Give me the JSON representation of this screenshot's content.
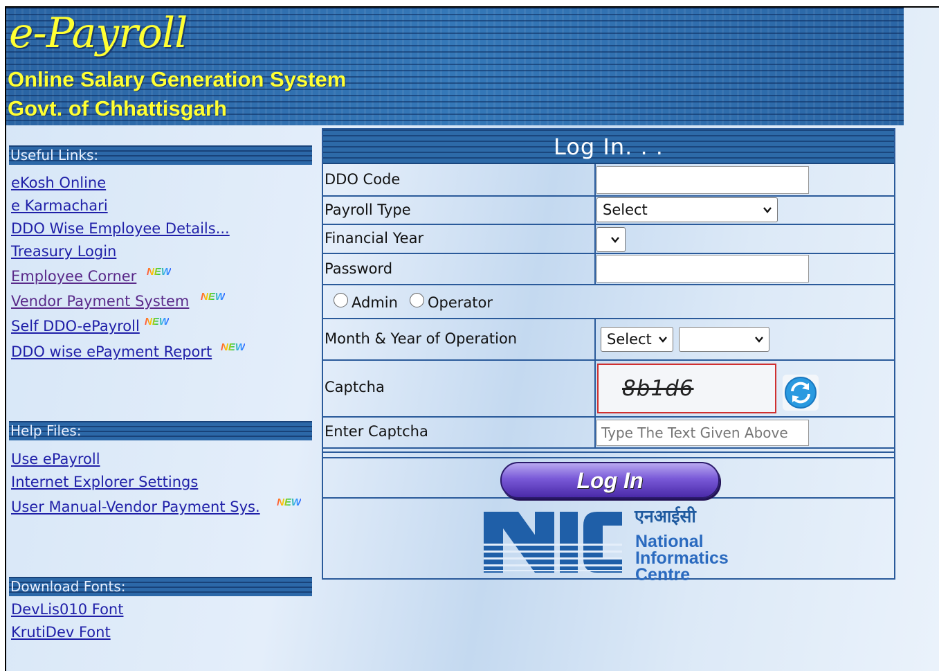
{
  "banner": {
    "title": "e-Payroll",
    "subtitle1": "Online Salary Generation System",
    "subtitle2": "Govt. of Chhattisgarh"
  },
  "sidebar": {
    "useful_links_heading": "Useful Links:",
    "useful_links": [
      {
        "label": "eKosh Online",
        "new": false,
        "visited": false
      },
      {
        "label": "e Karmachari",
        "new": false,
        "visited": false
      },
      {
        "label": "DDO Wise Employee Details...",
        "new": false,
        "visited": false
      },
      {
        "label": "Treasury Login",
        "new": false,
        "visited": false
      },
      {
        "label": "Employee Corner",
        "new": true,
        "visited": true
      },
      {
        "label": "Vendor Payment System",
        "new": true,
        "visited": true
      },
      {
        "label": "Self DDO-ePayroll",
        "new": true,
        "visited": false
      },
      {
        "label": "DDO wise ePayment Report",
        "new": true,
        "visited": false
      }
    ],
    "help_heading": "Help Files:",
    "help_links": [
      {
        "label": "Use ePayroll",
        "new": false
      },
      {
        "label": "Internet Explorer Settings",
        "new": false
      },
      {
        "label": "User Manual-Vendor Payment Sys.",
        "new": true
      }
    ],
    "fonts_heading": "Download Fonts:",
    "font_links": [
      {
        "label": "DevLis010 Font"
      },
      {
        "label": "KrutiDev Font"
      }
    ],
    "new_badge": "NEW"
  },
  "login": {
    "title": "Log In. . .",
    "ddo_code_label": "DDO Code",
    "ddo_code_value": "",
    "payroll_type_label": "Payroll Type",
    "payroll_type_value": "Select",
    "financial_year_label": "Financial Year",
    "financial_year_value": "",
    "password_label": "Password",
    "password_value": "",
    "role_admin": "Admin",
    "role_operator": "Operator",
    "month_year_label": "Month & Year of Operation",
    "month_value": "Select",
    "year_value": "",
    "captcha_label": "Captcha",
    "captcha_text": "8b1d6",
    "enter_captcha_label": "Enter Captcha",
    "enter_captcha_placeholder": "Type The Text Given Above",
    "login_button": "Log In"
  },
  "nic": {
    "hindi": "एनआईसी",
    "line1": "National",
    "line2": "Informatics",
    "line3": "Centre"
  },
  "colors": {
    "banner_blue": "#2d6aa8",
    "banner_text": "#ffff33",
    "link": "#1f1fa8",
    "visited_link": "#5a2a8a",
    "panel_border": "#2a5a9a",
    "captcha_border": "#d03030",
    "login_button": "#7a5ad8",
    "nic_blue": "#1f5a9f"
  }
}
